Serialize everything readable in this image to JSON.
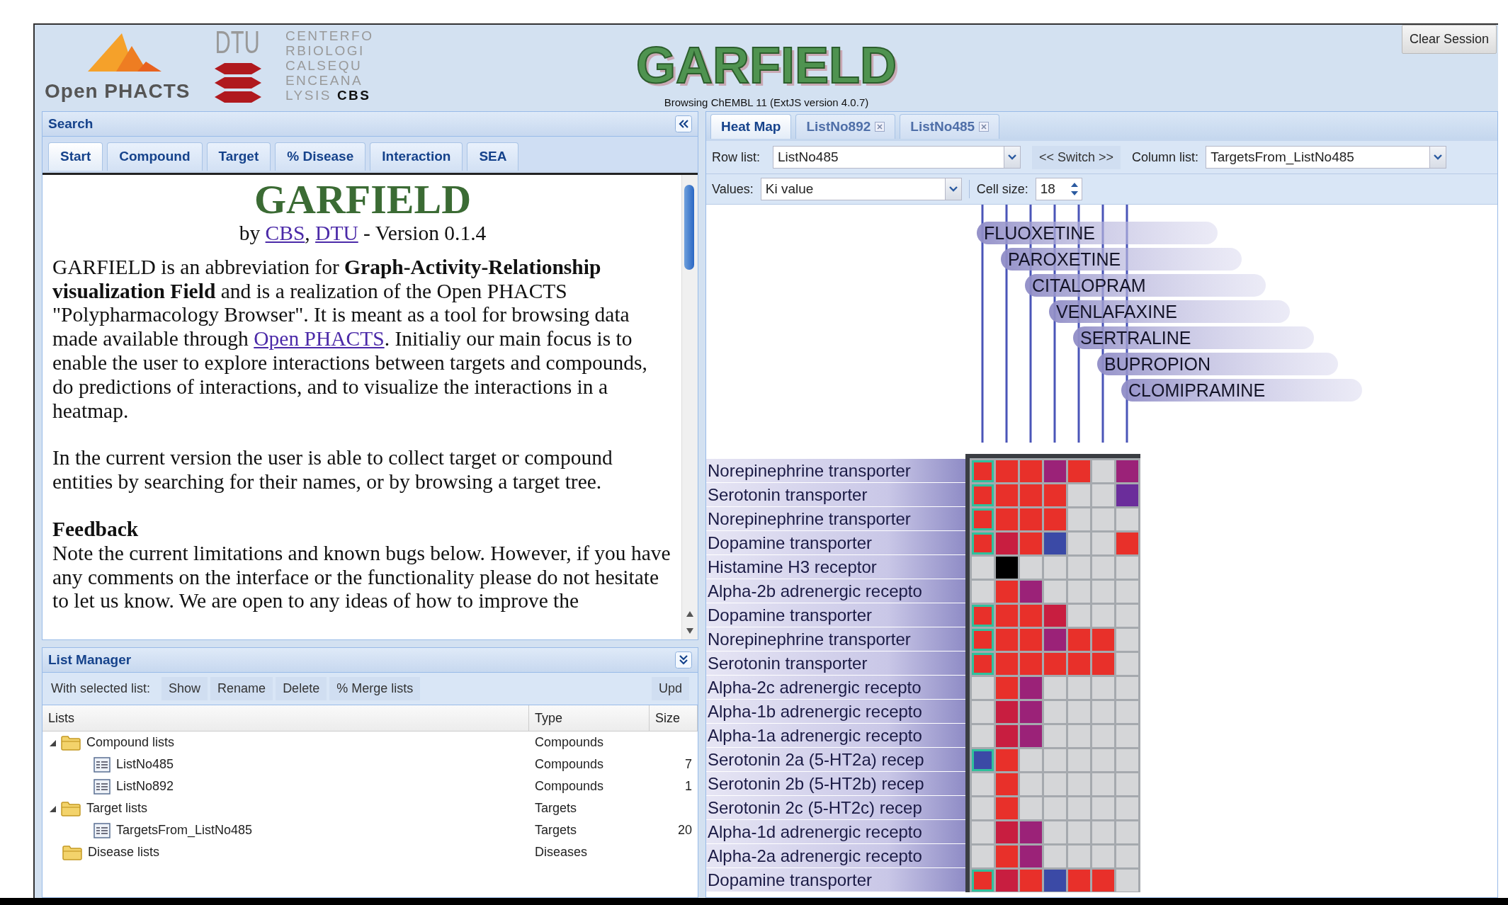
{
  "header": {
    "logo_text": "Open PHACTS",
    "dtu_text": "DTU",
    "cbs_lines": [
      "CENTERFO",
      "RBIOLOGI",
      "CALSEQU",
      "ENCEANA",
      "LYSIS"
    ],
    "cbs_bold": "CBS",
    "title": "GARFIELD",
    "subtitle": "Browsing ChEMBL 11 (ExtJS version 4.0.7)",
    "clear_button": "Clear Session"
  },
  "search_panel": {
    "title": "Search",
    "tabs": [
      {
        "label": "Start",
        "selected": true
      },
      {
        "label": "Compound",
        "selected": false
      },
      {
        "label": "Target",
        "selected": false
      },
      {
        "label": "% Disease",
        "selected": false
      },
      {
        "label": "Interaction",
        "selected": false
      },
      {
        "label": "SEA",
        "selected": false
      }
    ],
    "heading": "GARFIELD",
    "byline": [
      {
        "kind": "text",
        "text": "by "
      },
      {
        "kind": "link",
        "text": "CBS"
      },
      {
        "kind": "text",
        "text": ", "
      },
      {
        "kind": "link",
        "text": "DTU"
      },
      {
        "kind": "text",
        "text": " - Version 0.1.4"
      }
    ],
    "blocks": [
      {
        "kind": "paragraph",
        "segments": [
          {
            "kind": "text",
            "text": "GARFIELD is an abbreviation for **Graph-Activity-Relationship visualization Field** and is a realization of the Open PHACTS \"Polypharmacology Browser\". It is meant as a tool for browsing data made available through "
          },
          {
            "kind": "link",
            "text": "Open PHACTS"
          },
          {
            "kind": "text",
            "text": ". Initialiy our main focus is to enable the user to explore interactions between targets and compounds, do predictions of interactions, and to visualize the interactions in a heatmap."
          }
        ]
      },
      {
        "kind": "paragraph",
        "segments": [
          {
            "kind": "text",
            "text": "In the current version the user is able to collect target or compound entities by searching for their names, or by browsing a target tree."
          }
        ]
      },
      {
        "kind": "heading",
        "segments": [
          {
            "kind": "text",
            "text": "Feedback"
          }
        ]
      },
      {
        "kind": "continuation",
        "segments": [
          {
            "kind": "text",
            "text": "Note the current limitations and known bugs below. However, if you have any comments on the interface or the functionality please do not hesitate to let us know. We are open to any ideas of how to improve the"
          }
        ]
      }
    ]
  },
  "list_manager": {
    "title": "List Manager",
    "toolbar_label": "With selected list:",
    "buttons": [
      "Show",
      "Rename",
      "Delete",
      "% Merge lists",
      "Upd"
    ],
    "columns": [
      "Lists",
      "Type",
      "Size"
    ],
    "tree": [
      {
        "kind": "folder",
        "name": "Compound lists",
        "type": "Compounds",
        "expanded": true,
        "children": [
          {
            "kind": "list",
            "name": "ListNo485",
            "type": "Compounds",
            "size": "7"
          },
          {
            "kind": "list",
            "name": "ListNo892",
            "type": "Compounds",
            "size": "1"
          }
        ]
      },
      {
        "kind": "folder",
        "name": "Target lists",
        "type": "Targets",
        "expanded": true,
        "children": [
          {
            "kind": "list",
            "name": "TargetsFrom_ListNo485",
            "type": "Targets",
            "size": "20"
          }
        ]
      },
      {
        "kind": "folder",
        "name": "Disease lists",
        "type": "Diseases"
      }
    ]
  },
  "main_panel": {
    "tabs": [
      {
        "label": "Heat Map",
        "selected": true,
        "closable": false
      },
      {
        "label": "ListNo892",
        "selected": false,
        "closable": true
      },
      {
        "label": "ListNo485",
        "selected": false,
        "closable": true
      }
    ],
    "row_list": {
      "label": "Row list:",
      "value": "ListNo485"
    },
    "switch_button": "<< Switch >>",
    "column_list": {
      "label": "Column list:",
      "value": "TargetsFrom_ListNo485"
    },
    "values": {
      "label": "Values:",
      "value": "Ki value"
    },
    "cell_size": {
      "label": "Cell size:",
      "value": "18"
    },
    "heatmap": {
      "columns": [
        "FLUOXETINE",
        "PAROXETINE",
        "CITALOPRAM",
        "VENLAFAXINE",
        "SERTRALINE",
        "BUPROPION",
        "CLOMIPRAMINE"
      ],
      "rows": [
        {
          "label": "Norepinephrine transporter",
          "outlined": true,
          "cells": [
            {
              "color": "#e8302a"
            },
            {
              "color": "#e8302a"
            },
            {
              "color": "#e8302a"
            },
            {
              "color": "#9b2278"
            },
            {
              "color": "#e8302a"
            },
            {
              "color": "#d5d6d8"
            },
            {
              "color": "#9b2278"
            }
          ]
        },
        {
          "label": "Serotonin transporter",
          "outlined": true,
          "cells": [
            {
              "color": "#e8302a"
            },
            {
              "color": "#e8302a"
            },
            {
              "color": "#e8302a"
            },
            {
              "color": "#e8302a"
            },
            {
              "color": "#d5d6d8"
            },
            {
              "color": "#d5d6d8"
            },
            {
              "color": "#6b2d9b"
            }
          ]
        },
        {
          "label": "Norepinephrine transporter",
          "outlined": true,
          "cells": [
            {
              "color": "#e8302a"
            },
            {
              "color": "#e8302a"
            },
            {
              "color": "#e8302a"
            },
            {
              "color": "#e8302a"
            },
            {
              "color": "#d5d6d8"
            },
            {
              "color": "#d5d6d8"
            },
            {
              "color": "#d5d6d8"
            }
          ]
        },
        {
          "label": "Dopamine transporter",
          "outlined": true,
          "cells": [
            {
              "color": "#e8302a"
            },
            {
              "color": "#c81e40"
            },
            {
              "color": "#e8302a"
            },
            {
              "color": "#3b4aa6"
            },
            {
              "color": "#d5d6d8"
            },
            {
              "color": "#d5d6d8"
            },
            {
              "color": "#e8302a"
            }
          ]
        },
        {
          "label": "Histamine H3 receptor",
          "outlined": false,
          "cells": [
            {
              "color": "#d5d6d8"
            },
            {
              "color": "#000000"
            },
            {
              "color": "#d5d6d8"
            },
            {
              "color": "#d5d6d8"
            },
            {
              "color": "#d5d6d8"
            },
            {
              "color": "#d5d6d8"
            },
            {
              "color": "#d5d6d8"
            }
          ]
        },
        {
          "label": "Alpha-2b adrenergic recepto",
          "outlined": false,
          "cells": [
            {
              "color": "#d5d6d8"
            },
            {
              "color": "#e8302a"
            },
            {
              "color": "#9b2278"
            },
            {
              "color": "#d5d6d8"
            },
            {
              "color": "#d5d6d8"
            },
            {
              "color": "#d5d6d8"
            },
            {
              "color": "#d5d6d8"
            }
          ]
        },
        {
          "label": "Dopamine transporter",
          "outlined": true,
          "cells": [
            {
              "color": "#e8302a"
            },
            {
              "color": "#e8302a"
            },
            {
              "color": "#e8302a"
            },
            {
              "color": "#c81e40"
            },
            {
              "color": "#d5d6d8"
            },
            {
              "color": "#d5d6d8"
            },
            {
              "color": "#d5d6d8"
            }
          ]
        },
        {
          "label": "Norepinephrine transporter",
          "outlined": true,
          "cells": [
            {
              "color": "#e8302a"
            },
            {
              "color": "#e8302a"
            },
            {
              "color": "#e8302a"
            },
            {
              "color": "#9b2278"
            },
            {
              "color": "#e8302a"
            },
            {
              "color": "#e8302a"
            },
            {
              "color": "#d5d6d8"
            }
          ]
        },
        {
          "label": "Serotonin transporter",
          "outlined": true,
          "cells": [
            {
              "color": "#e8302a"
            },
            {
              "color": "#e8302a"
            },
            {
              "color": "#e8302a"
            },
            {
              "color": "#e8302a"
            },
            {
              "color": "#e8302a"
            },
            {
              "color": "#e8302a"
            },
            {
              "color": "#d5d6d8"
            }
          ]
        },
        {
          "label": "Alpha-2c adrenergic recepto",
          "outlined": false,
          "cells": [
            {
              "color": "#d5d6d8"
            },
            {
              "color": "#e8302a"
            },
            {
              "color": "#9b2278"
            },
            {
              "color": "#d5d6d8"
            },
            {
              "color": "#d5d6d8"
            },
            {
              "color": "#d5d6d8"
            },
            {
              "color": "#d5d6d8"
            }
          ]
        },
        {
          "label": "Alpha-1b adrenergic recepto",
          "outlined": false,
          "cells": [
            {
              "color": "#d5d6d8"
            },
            {
              "color": "#c81e40"
            },
            {
              "color": "#9b2278"
            },
            {
              "color": "#d5d6d8"
            },
            {
              "color": "#d5d6d8"
            },
            {
              "color": "#d5d6d8"
            },
            {
              "color": "#d5d6d8"
            }
          ]
        },
        {
          "label": "Alpha-1a adrenergic recepto",
          "outlined": false,
          "cells": [
            {
              "color": "#d5d6d8"
            },
            {
              "color": "#c81e40"
            },
            {
              "color": "#9b2278"
            },
            {
              "color": "#d5d6d8"
            },
            {
              "color": "#d5d6d8"
            },
            {
              "color": "#d5d6d8"
            },
            {
              "color": "#d5d6d8"
            }
          ]
        },
        {
          "label": "Serotonin 2a (5-HT2a) recep",
          "outlined": true,
          "cells": [
            {
              "color": "#3b4aa6"
            },
            {
              "color": "#e8302a"
            },
            {
              "color": "#d5d6d8"
            },
            {
              "color": "#d5d6d8"
            },
            {
              "color": "#d5d6d8"
            },
            {
              "color": "#d5d6d8"
            },
            {
              "color": "#d5d6d8"
            }
          ]
        },
        {
          "label": "Serotonin 2b (5-HT2b) recep",
          "outlined": false,
          "cells": [
            {
              "color": "#d5d6d8"
            },
            {
              "color": "#e8302a"
            },
            {
              "color": "#d5d6d8"
            },
            {
              "color": "#d5d6d8"
            },
            {
              "color": "#d5d6d8"
            },
            {
              "color": "#d5d6d8"
            },
            {
              "color": "#d5d6d8"
            }
          ]
        },
        {
          "label": "Serotonin 2c (5-HT2c) recep",
          "outlined": false,
          "cells": [
            {
              "color": "#d5d6d8"
            },
            {
              "color": "#e8302a"
            },
            {
              "color": "#d5d6d8"
            },
            {
              "color": "#d5d6d8"
            },
            {
              "color": "#d5d6d8"
            },
            {
              "color": "#d5d6d8"
            },
            {
              "color": "#d5d6d8"
            }
          ]
        },
        {
          "label": "Alpha-1d adrenergic recepto",
          "outlined": false,
          "cells": [
            {
              "color": "#d5d6d8"
            },
            {
              "color": "#c81e40"
            },
            {
              "color": "#9b2278"
            },
            {
              "color": "#d5d6d8"
            },
            {
              "color": "#d5d6d8"
            },
            {
              "color": "#d5d6d8"
            },
            {
              "color": "#d5d6d8"
            }
          ]
        },
        {
          "label": "Alpha-2a adrenergic recepto",
          "outlined": false,
          "cells": [
            {
              "color": "#d5d6d8"
            },
            {
              "color": "#e8302a"
            },
            {
              "color": "#9b2278"
            },
            {
              "color": "#d5d6d8"
            },
            {
              "color": "#d5d6d8"
            },
            {
              "color": "#d5d6d8"
            },
            {
              "color": "#d5d6d8"
            }
          ]
        },
        {
          "label": "Dopamine transporter",
          "outlined": true,
          "cells": [
            {
              "color": "#e8302a"
            },
            {
              "color": "#c81e40"
            },
            {
              "color": "#e8302a"
            },
            {
              "color": "#3b4aa6"
            },
            {
              "color": "#e8302a"
            },
            {
              "color": "#e8302a"
            },
            {
              "color": "#d5d6d8"
            }
          ]
        }
      ]
    }
  }
}
